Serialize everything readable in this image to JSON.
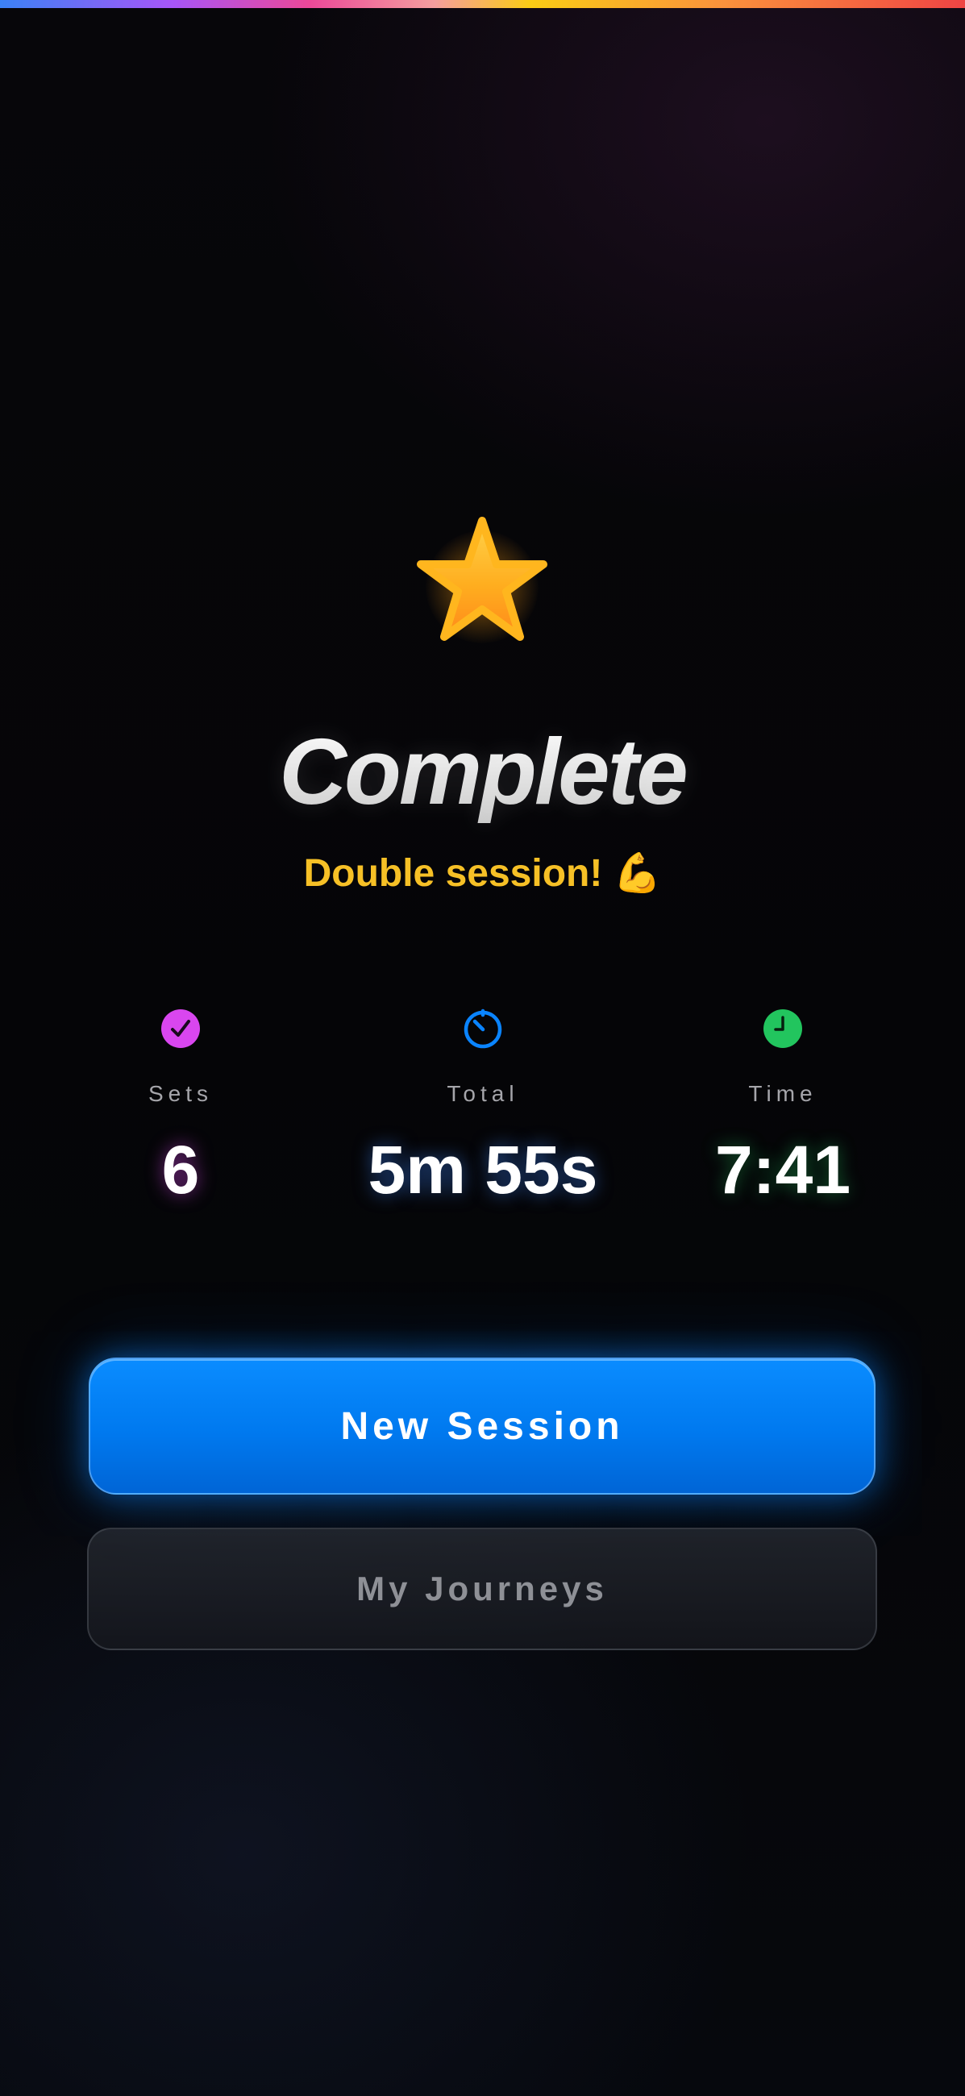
{
  "screen": {
    "title": "Complete",
    "subtitle": "Double session! 💪"
  },
  "stats": [
    {
      "label": "Sets",
      "value": "6",
      "icon": "checkmark-circle-icon",
      "color": "#d946ef"
    },
    {
      "label": "Total",
      "value": "5m 55s",
      "icon": "stopwatch-icon",
      "color": "#0a84ff"
    },
    {
      "label": "Time",
      "value": "7:41",
      "icon": "clock-icon",
      "color": "#22c55e"
    }
  ],
  "actions": {
    "primary_label": "New Session",
    "secondary_label": "My Journeys"
  },
  "icons": {
    "hero": "star-icon"
  },
  "colors": {
    "accent_blue": "#0a84ff",
    "star_gold": "#ffb020",
    "subtitle_yellow": "#f6c026"
  }
}
